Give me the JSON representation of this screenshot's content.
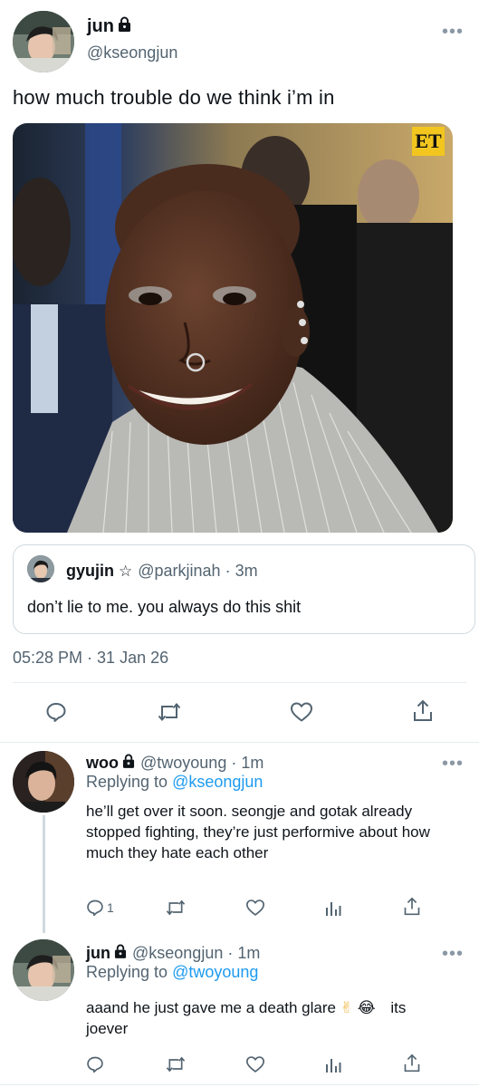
{
  "main_tweet": {
    "display_name": "jun",
    "handle": "@kseongjun",
    "text": "how much trouble do we think i’m in",
    "media_badge": "ET",
    "timestamp": "05:28 PM · 31 Jan 26",
    "quote": {
      "display_name": "gyujin",
      "star": "☆",
      "handle": "@parkjinah",
      "time": "· 3m",
      "text": "don’t lie to me. you always do this shit"
    }
  },
  "replies": [
    {
      "display_name": "woo",
      "handle": "@twoyoung",
      "time": "· 1m",
      "replying_label": "Replying to",
      "replying_to": "@kseongjun",
      "text": "he’ll get over it soon. seongje and gotak already stopped fighting, they’re just performive about how much they hate each other",
      "reply_count": "1"
    },
    {
      "display_name": "jun",
      "handle": "@kseongjun",
      "time": "· 1m",
      "replying_label": "Replying to",
      "replying_to": "@twoyoung",
      "text_1": "aaand he just gave me a death glare",
      "emoji_1": "✌",
      "emoji_2": "😂",
      "text_2": "its",
      "text_3": "joever"
    }
  ],
  "more_label": "•••",
  "colors": {
    "accent": "#1d9bf0",
    "muted": "#536471",
    "divider": "#e6ecf0"
  }
}
